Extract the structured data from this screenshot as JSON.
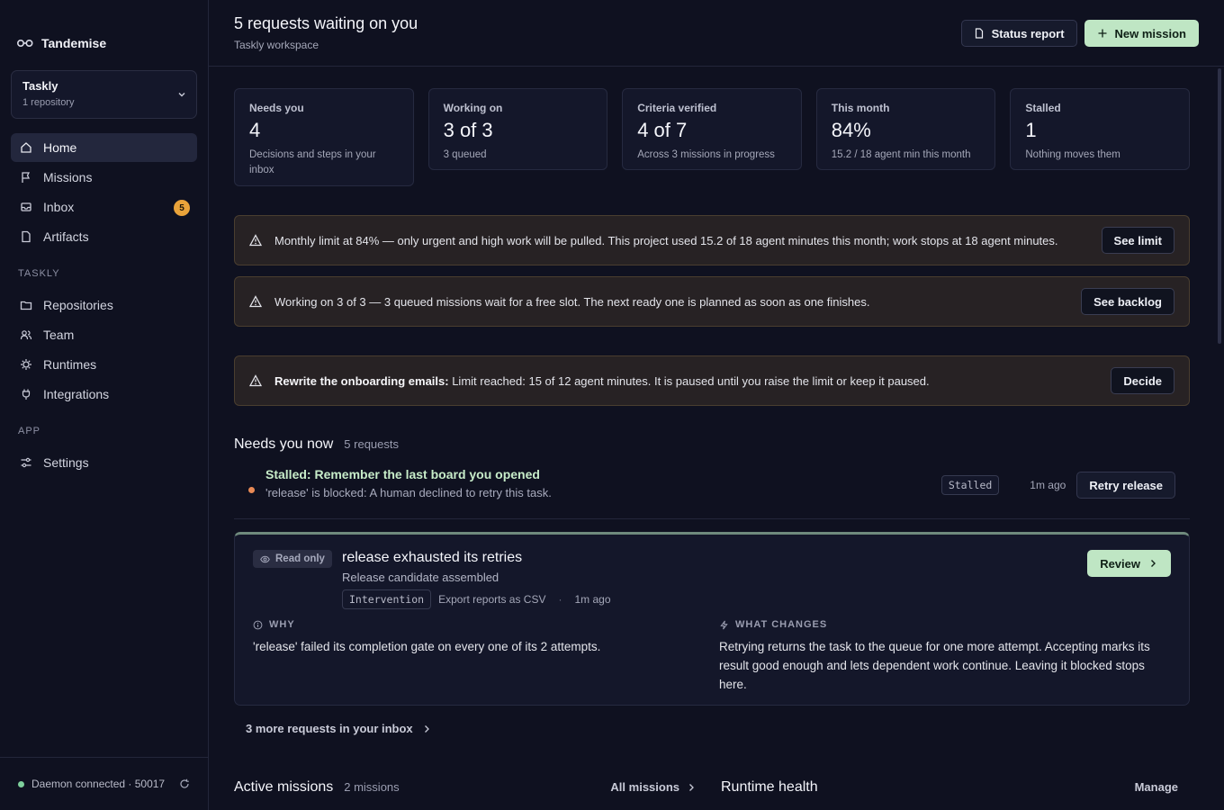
{
  "sidebar": {
    "brand": "Tandemise",
    "workspace": {
      "name": "Taskly",
      "sub": "1 repository"
    },
    "nav_main": [
      {
        "label": "Home",
        "icon": "home-icon",
        "active": true
      },
      {
        "label": "Missions",
        "icon": "flag-icon"
      },
      {
        "label": "Inbox",
        "icon": "inbox-icon",
        "badge": "5"
      },
      {
        "label": "Artifacts",
        "icon": "file-icon"
      }
    ],
    "section_taskly": "TASKLY",
    "nav_taskly": [
      {
        "label": "Repositories",
        "icon": "folder-icon"
      },
      {
        "label": "Team",
        "icon": "users-icon"
      },
      {
        "label": "Runtimes",
        "icon": "cpu-icon"
      },
      {
        "label": "Integrations",
        "icon": "plug-icon"
      }
    ],
    "section_app": "APP",
    "nav_app": [
      {
        "label": "Settings",
        "icon": "sliders-icon"
      }
    ],
    "footer": "Daemon connected · 50017"
  },
  "header": {
    "title": "5 requests waiting on you",
    "subtitle": "Taskly workspace",
    "status_report": "Status report",
    "new_mission": "New mission"
  },
  "stats": [
    {
      "label": "Needs you",
      "value": "4",
      "desc": "Decisions and steps in your inbox"
    },
    {
      "label": "Working on",
      "value": "3 of 3",
      "desc": "3 queued"
    },
    {
      "label": "Criteria verified",
      "value": "4 of 7",
      "desc": "Across 3 missions in progress"
    },
    {
      "label": "This month",
      "value": "84%",
      "desc": "15.2 / 18 agent min this month"
    },
    {
      "label": "Stalled",
      "value": "1",
      "desc": "Nothing moves them"
    }
  ],
  "alerts": {
    "limit": {
      "msg": "Monthly limit at 84% — only urgent and high work will be pulled. This project used 15.2 of 18 agent minutes this month; work stops at 18 agent minutes.",
      "action": "See limit"
    },
    "working": {
      "msg": "Working on 3 of 3 — 3 queued missions wait for a free slot. The next ready one is planned as soon as one finishes.",
      "action": "See backlog"
    },
    "paused": {
      "bold": "Rewrite the onboarding emails:",
      "msg": " Limit reached: 15 of 12 agent minutes. It is paused until you raise the limit or keep it paused.",
      "action": "Decide"
    }
  },
  "needs": {
    "title": "Needs you now",
    "count": "5 requests",
    "row": {
      "title": "Stalled: Remember the last board you opened",
      "sub": "'release' is blocked: A human declined to retry this task.",
      "tag": "Stalled",
      "ago": "1m ago",
      "action": "Retry release"
    },
    "card": {
      "chip": "Read only",
      "title": "release exhausted its retries",
      "sub": "Release candidate assembled",
      "tag": "Intervention",
      "mission": "Export reports as CSV",
      "sep": "·",
      "ago": "1m ago",
      "action": "Review",
      "why_label": "WHY",
      "why": "'release' failed its completion gate on every one of its 2 attempts.",
      "changes_label": "WHAT CHANGES",
      "changes": "Retrying returns the task to the queue for one more attempt. Accepting marks its result good enough and lets dependent work continue. Leaving it blocked stops here."
    },
    "more": "3 more requests in your inbox"
  },
  "active": {
    "title": "Active missions",
    "count": "2 missions",
    "link": "All missions"
  },
  "runtime": {
    "title": "Runtime health",
    "link": "Manage"
  },
  "colors": {
    "accent": "#bfe6c4",
    "warning": "#e9a33a",
    "stalled_dot": "#e98a55",
    "connected": "#7ed09c"
  }
}
